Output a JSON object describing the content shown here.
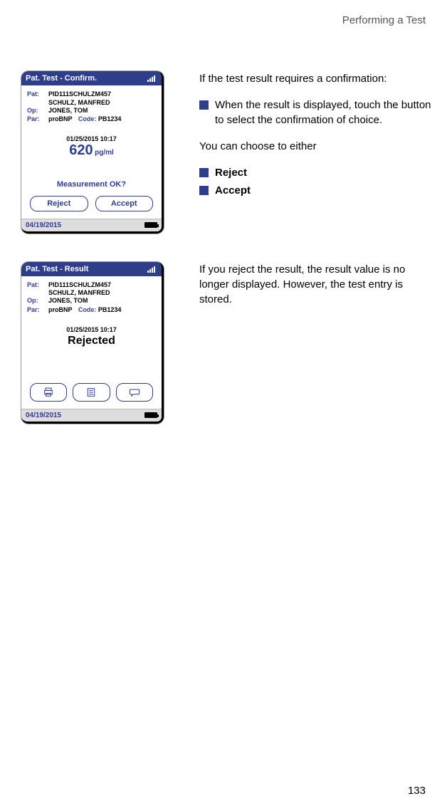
{
  "header": {
    "title": "Performing a Test"
  },
  "page_number": "133",
  "screens": {
    "confirm": {
      "title": "Pat. Test - Confirm.",
      "pat_label": "Pat:",
      "pat_id": "PID111SCHULZM457",
      "pat_name": "SCHULZ, MANFRED",
      "op_label": "Op:",
      "op_val": "JONES, TOM",
      "par_label": "Par:",
      "par_val": "proBNP",
      "code_label": "Code:",
      "code_val": "PB1234",
      "timestamp": "01/25/2015  10:17",
      "value": "620",
      "unit": "pg/ml",
      "meas_prompt": "Measurement OK?",
      "reject_btn": "Reject",
      "accept_btn": "Accept",
      "footer_date": "04/19/2015"
    },
    "result": {
      "title": "Pat. Test - Result",
      "pat_label": "Pat:",
      "pat_id": "PID111SCHULZM457",
      "pat_name": "SCHULZ, MANFRED",
      "op_label": "Op:",
      "op_val": "JONES, TOM",
      "par_label": "Par:",
      "par_val": "proBNP",
      "code_label": "Code:",
      "code_val": "PB1234",
      "timestamp": "01/25/2015  10:17",
      "status": "Rejected",
      "footer_date": "04/19/2015"
    }
  },
  "text": {
    "p1": "If the test result requires a confirmation:",
    "b1": "When the result is displayed, touch the button to select the confirmation of choice.",
    "p2": "You can choose to either",
    "opt1": "Reject",
    "opt2": "Accept",
    "p3": "If you reject the result, the result value is no longer displayed. However, the test entry is stored."
  }
}
